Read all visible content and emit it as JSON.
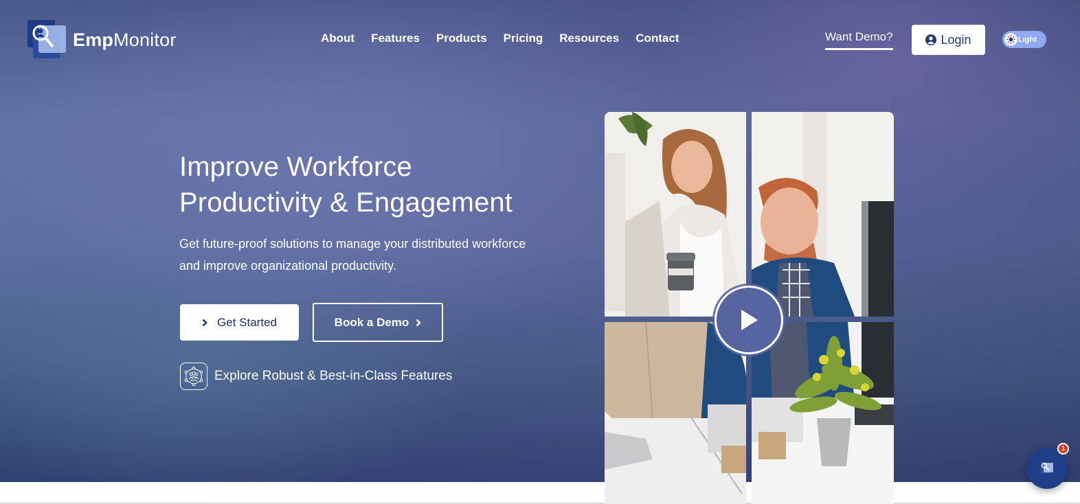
{
  "brand": {
    "name_bold": "Emp",
    "name_light": "Monitor"
  },
  "nav": {
    "items": [
      {
        "label": "About"
      },
      {
        "label": "Features"
      },
      {
        "label": "Products"
      },
      {
        "label": "Pricing"
      },
      {
        "label": "Resources"
      },
      {
        "label": "Contact"
      }
    ]
  },
  "header_actions": {
    "want_demo": "Want Demo?",
    "login": "Login",
    "theme_toggle": "Light"
  },
  "hero": {
    "headline_line1": "Improve Workforce",
    "headline_line2": "Productivity & Engagement",
    "subtext": "Get future-proof solutions to manage your distributed workforce and improve organizational productivity.",
    "primary_cta": "Get Started",
    "secondary_cta": "Book a Demo",
    "explore_link": "Explore Robust & Best-in-Class Features"
  },
  "media": {
    "play_label": "Play video"
  },
  "chat": {
    "badge_count": "1"
  },
  "colors": {
    "brand_navy": "#1f3a73",
    "toggle_blue": "#91a9f2",
    "badge_red": "#e0341c"
  }
}
